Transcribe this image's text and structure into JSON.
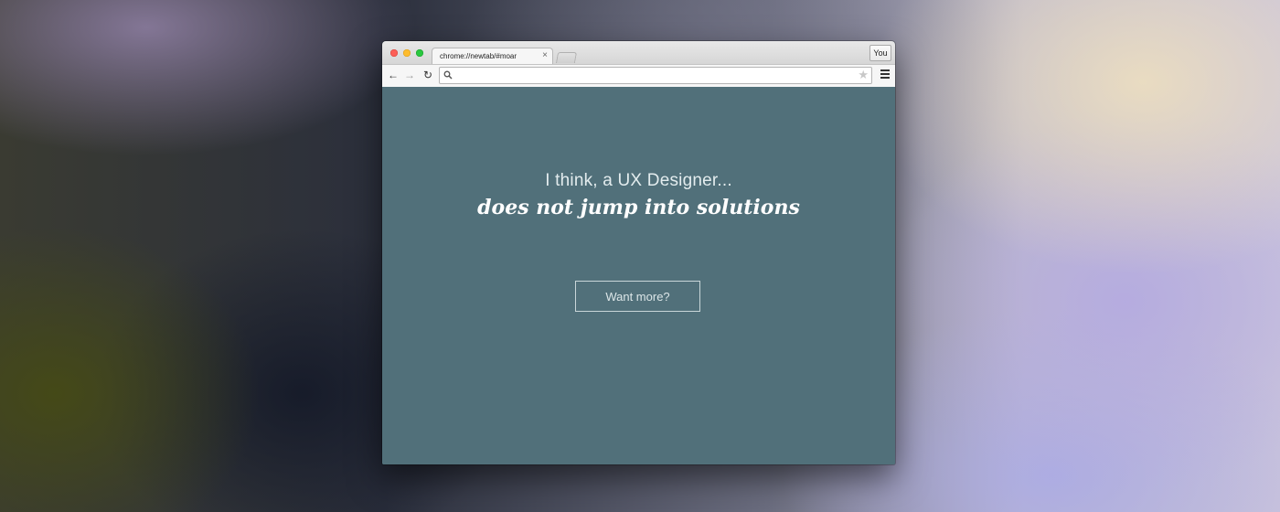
{
  "browser": {
    "tab_title": "chrome://newtab/#moar",
    "tab_close_glyph": "×",
    "profile_label": "You",
    "address_value": "",
    "icons": {
      "back": "←",
      "forward": "→",
      "reload": "↻",
      "search": "🔍",
      "star": "★"
    }
  },
  "page": {
    "tagline": "I think, a UX Designer...",
    "headline": "does not jump into solutions",
    "button_label": "Want more?",
    "background_color": "#51707a"
  }
}
